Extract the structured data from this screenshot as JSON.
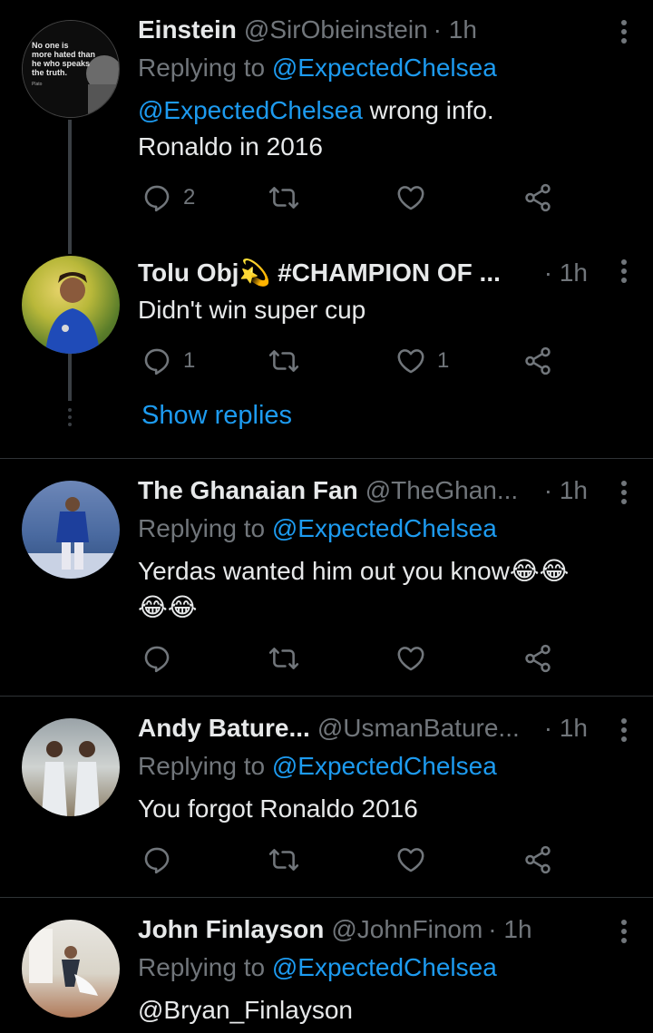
{
  "tweets": [
    {
      "name": "Einstein",
      "handle": "@SirObieinstein",
      "time": "· 1h",
      "reply_label": "Replying to",
      "reply_handle": "@ExpectedChelsea",
      "mention": "@ExpectedChelsea",
      "text_1": " wrong info.",
      "text_2": "Ronaldo in 2016",
      "replies": "2",
      "avatar_text": [
        "No one is",
        "more hated than",
        "he who speaks",
        "the truth."
      ],
      "avatar_sign": "Plato"
    },
    {
      "name": "Tolu Obj💫 #CHAMPION OF ...",
      "time": "· 1h",
      "text": "Didn't win super cup",
      "replies": "1",
      "likes": "1",
      "show_replies": "Show replies"
    },
    {
      "name": "The Ghanaian Fan",
      "handle": "@TheGhan...",
      "time": "· 1h",
      "reply_label": "Replying to",
      "reply_handle": "@ExpectedChelsea",
      "text_1": "Yerdas wanted him out you know😂😂",
      "text_2": "😂😂"
    },
    {
      "name": "Andy Bature...",
      "handle": "@UsmanBature...",
      "time": "· 1h",
      "reply_label": "Replying to",
      "reply_handle": "@ExpectedChelsea",
      "text": "You forgot Ronaldo 2016"
    },
    {
      "name": "John Finlayson",
      "handle": "@JohnFinom",
      "time": "· 1h",
      "reply_label": "Replying to",
      "reply_handle": "@ExpectedChelsea",
      "text": "@Bryan_Finlayson"
    }
  ],
  "colors": {
    "background": "#000000",
    "text": "#e7e9ea",
    "muted": "#71767b",
    "accent": "#1d9bf0",
    "divider": "#2f3336"
  },
  "icons": {
    "reply": "reply-icon",
    "retweet": "retweet-icon",
    "like": "heart-icon",
    "share": "share-icon",
    "more": "more-icon"
  }
}
